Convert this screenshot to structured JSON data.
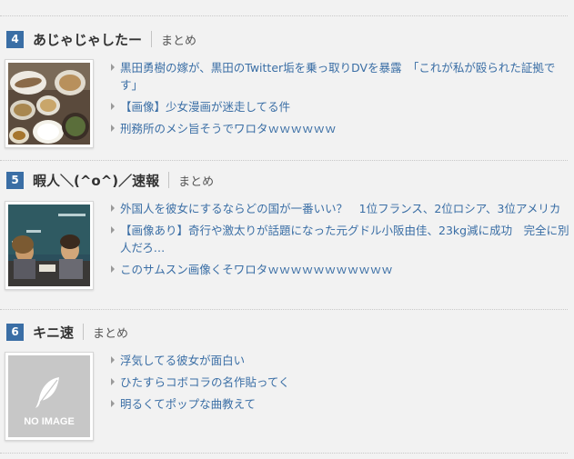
{
  "sites": [
    {
      "rank": "4",
      "name": "あじゃじゃしたー",
      "tag": "まとめ",
      "thumbnail": "food-tray-photo",
      "articles": [
        "黒田勇樹の嫁が、黒田のTwitter垢を乗っ取りDVを暴露　「これが私が殴られた証拠です」",
        "【画像】少女漫画が迷走してる件",
        "刑務所のメシ旨そうでワロタｗｗｗｗｗｗ"
      ]
    },
    {
      "rank": "5",
      "name": "暇人＼(^o^)／速報",
      "tag": "まとめ",
      "thumbnail": "classroom-photo",
      "articles": [
        "外国人を彼女にするならどの国が一番いい？　1位フランス、2位ロシア、3位アメリカ",
        "【画像あり】奇行や激太りが話題になった元グドル小阪由佳、23kg減に成功　完全に別人だろ…",
        "このサムスン画像くそワロタｗｗｗｗｗｗｗｗｗｗｗ"
      ]
    },
    {
      "rank": "6",
      "name": "キニ速",
      "tag": "まとめ",
      "thumbnail": "no-image-placeholder",
      "no_image_text": "NO IMAGE",
      "articles": [
        "浮気してる彼女が面白い",
        "ひたすらコボコラの名作貼ってく",
        "明るくてポップな曲教えて"
      ]
    }
  ],
  "colors": {
    "accent": "#3a6ea5",
    "link": "#3a6ea5",
    "background": "#f2f2f2"
  }
}
